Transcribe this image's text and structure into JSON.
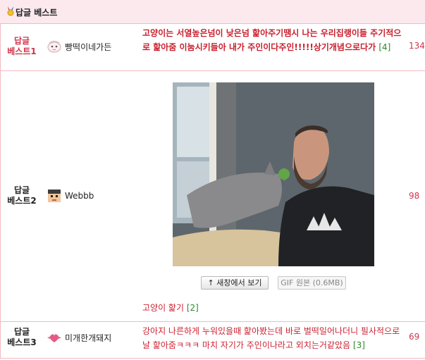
{
  "section": {
    "title": "답글 베스트"
  },
  "posts": [
    {
      "rank_line1": "답글",
      "rank_line2": "베스트1",
      "nickname": "빵떡이네가든",
      "text": "고양이는 서열높은넘이 낮은넘 핥아주기땜시 나는 우리집랭이들 주기적으로 핥아줌 이눔시키들아 내가 주인이다주인!!!!!상기개념으로다가",
      "comment_count": "[4]",
      "votes": "134"
    },
    {
      "rank_line1": "답글",
      "rank_line2": "베스트2",
      "nickname": "Webbb",
      "text": "고양이 핥기",
      "comment_count": "[2]",
      "votes": "98",
      "buttons": {
        "open_new_window": "↑ 새창에서 보기",
        "gif_original": "GIF 원본 (0.6MB)"
      }
    },
    {
      "rank_line1": "답글",
      "rank_line2": "베스트3",
      "nickname": "미개한개돼지",
      "text": "강아지 나른하게 누워있을때 핥아봤는데 바로 벌떡일어나더니 필사적으로 날 핥아줌ㅋㅋㅋ 마치 자기가 주인이나라고 외치는거같았음",
      "comment_count": "[3]",
      "votes": "69"
    }
  ],
  "colors": {
    "accent": "#d0344a",
    "header_bg": "#fbe9ee",
    "border": "#f2b9c4",
    "count_green": "#2c8a2c"
  }
}
